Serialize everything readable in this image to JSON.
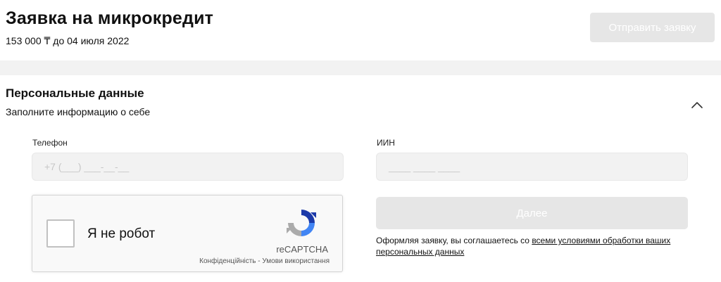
{
  "header": {
    "title": "Заявка на микрокредит",
    "subtitle": "153 000 ₸ до 04 июля 2022",
    "submit_label": "Отправить заявку"
  },
  "section": {
    "title": "Персональные данные",
    "subtitle": "Заполните информацию о себе",
    "collapse_icon": "chevron-up-icon"
  },
  "form": {
    "phone": {
      "label": "Телефон",
      "placeholder": "+7 (___) ___-__-__"
    },
    "iin": {
      "label": "ИИН",
      "placeholder": "____ ____ ____"
    },
    "next_label": "Далее",
    "consent_text": "Оформляя заявку, вы соглашаетесь со ",
    "consent_link": "всеми условиями обработки ваших персональных данных"
  },
  "captcha": {
    "label": "Я не робот",
    "brand": "reCAPTCHA",
    "privacy": "Конфіденційність",
    "separator": " - ",
    "terms": "Умови використання",
    "icon": "recaptcha-logo-icon"
  },
  "colors": {
    "disabled_button": "#e6e6e6",
    "band": "#f2f2f2",
    "input_bg": "#f2f2f2"
  }
}
